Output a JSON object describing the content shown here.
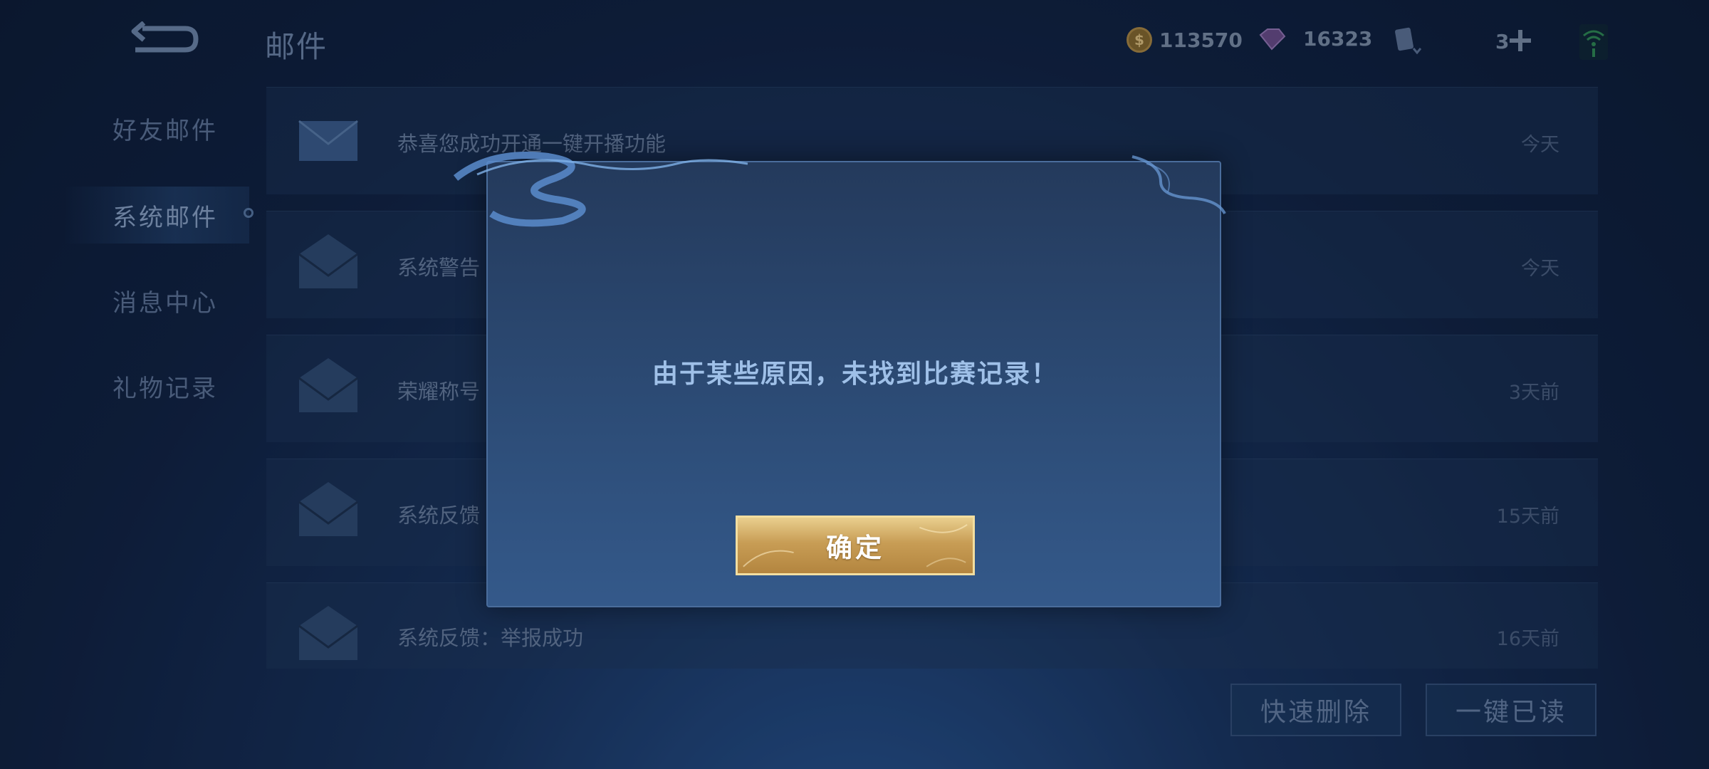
{
  "header": {
    "title": "邮件",
    "gold": "113570",
    "gems": "16323",
    "card_count": "3"
  },
  "sidebar": {
    "items": [
      {
        "label": "好友邮件"
      },
      {
        "label": "系统邮件"
      },
      {
        "label": "消息中心"
      },
      {
        "label": "礼物记录"
      }
    ]
  },
  "mails": [
    {
      "title": "恭喜您成功开通一键开播功能",
      "date": "今天"
    },
    {
      "title": "系统警告",
      "date": "今天"
    },
    {
      "title": "荣耀称号",
      "date": "3天前"
    },
    {
      "title": "系统反馈",
      "date": "15天前"
    },
    {
      "title": "系统反馈：举报成功",
      "date": "16天前"
    }
  ],
  "footer": {
    "quick_delete": "快速删除",
    "mark_all_read": "一键已读"
  },
  "dialog": {
    "message": "由于某些原因，未找到比赛记录！",
    "confirm": "确定"
  }
}
